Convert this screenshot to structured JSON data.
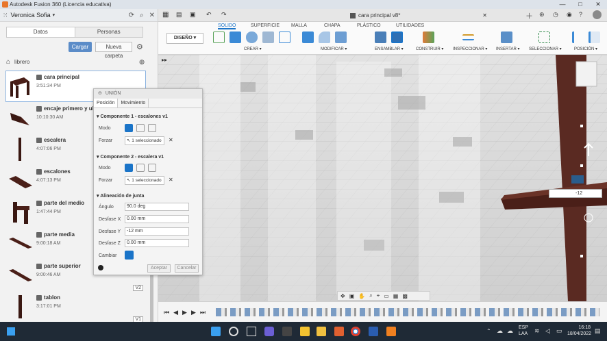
{
  "window": {
    "title": "Autodesk Fusion 360 (Licencia educativa)",
    "min": "—",
    "max": "□",
    "close": "✕"
  },
  "left_panel": {
    "user": "Veronica Sofia",
    "tab_data": "Datos",
    "tab_people": "Personas",
    "upload_label": "Cargar",
    "new_folder_label": "Nueva carpeta",
    "breadcrumb": "librero",
    "items": [
      {
        "name": "cara principal",
        "time": "3:51:34 PM",
        "version": ""
      },
      {
        "name": "encaje primero y ulti",
        "time": "10:10:30 AM",
        "version": ""
      },
      {
        "name": "escalera",
        "time": "4:07:06 PM",
        "version": ""
      },
      {
        "name": "escalones",
        "time": "4:07:13 PM",
        "version": ""
      },
      {
        "name": "parte del medio",
        "time": "1:47:44 PM",
        "version": ""
      },
      {
        "name": "parte media",
        "time": "9:00:18 AM",
        "version": ""
      },
      {
        "name": "parte superior",
        "time": "9:00:46 AM",
        "version": "V2"
      },
      {
        "name": "tablon",
        "time": "3:17:01 PM",
        "version": "V1"
      }
    ]
  },
  "document_tab": {
    "title": "cara principal v8*"
  },
  "ribbon": {
    "tabs": [
      "SOLIDO",
      "SUPERFICIE",
      "MALLA",
      "CHAPA",
      "PLÁSTICO",
      "UTILIDADES"
    ],
    "design_label": "DISEÑO",
    "groups": [
      "CREAR",
      "MODIFICAR",
      "ENSAMBLAR",
      "CONSTRUIR",
      "INSPECCIONAR",
      "INSERTAR",
      "SELECCIONAR",
      "POSICIÓN"
    ]
  },
  "dialog": {
    "title": "UNIÓN",
    "tab_position": "Posición",
    "tab_motion": "Movimiento",
    "comp1_title": "Componente 1 - escalones v1",
    "comp2_title": "Componente 2 - escalera v1",
    "mode_label": "Modo",
    "force_label": "Forzar",
    "selected_text": "1 seleccionado",
    "joint_title": "Alineación de junta",
    "angle_label": "Ángulo",
    "angle_value": "90.0 deg",
    "offset_x_label": "Desfase X",
    "offset_x_value": "0.00 mm",
    "offset_y_label": "Desfase Y",
    "offset_y_value": "-12 mm",
    "offset_z_label": "Desfase Z",
    "offset_z_value": "0.00 mm",
    "change_label": "Cambiar",
    "ok_label": "Aceptar",
    "cancel_label": "Cancelar"
  },
  "viewport": {
    "input_value": "-12"
  },
  "taskbar": {
    "lang": "ESP",
    "layout": "LAA",
    "time": "16:18",
    "date": "18/04/2022"
  },
  "colors": {
    "accent": "#1a74c8",
    "wood": "#5a2a22",
    "taskbar": "#1f2a36"
  }
}
